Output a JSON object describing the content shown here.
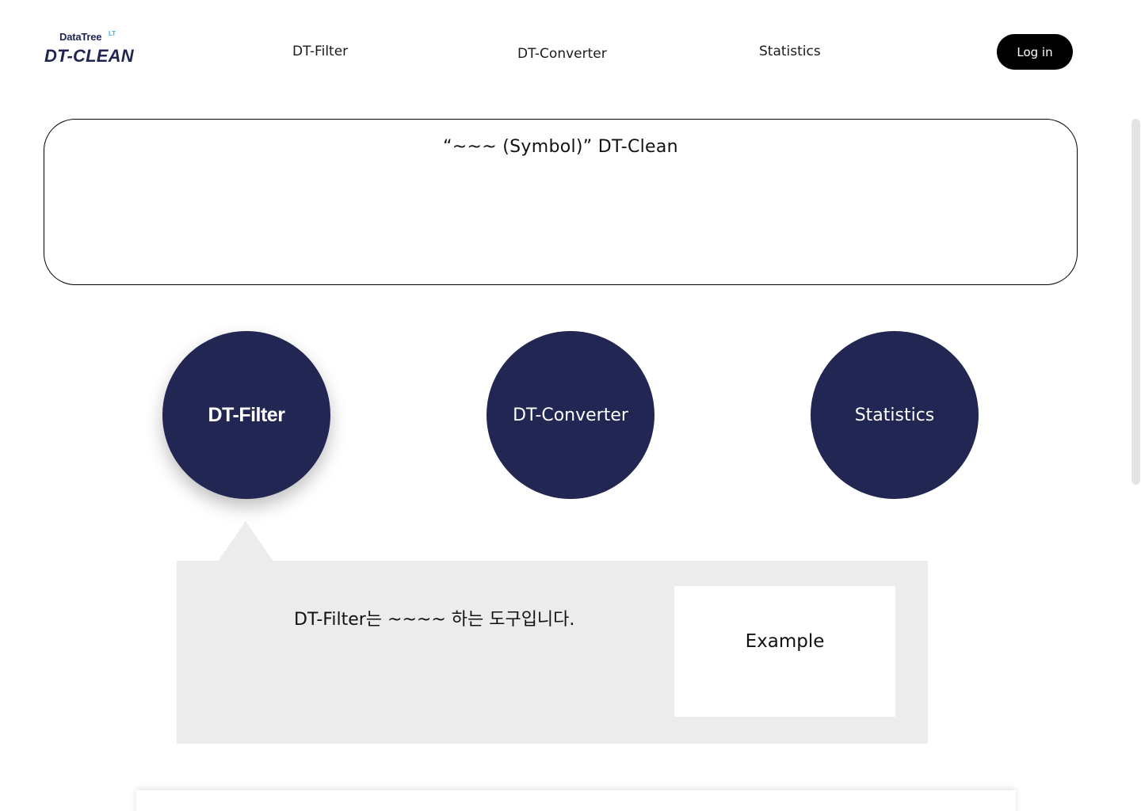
{
  "header": {
    "logo": {
      "top_text": "DataTree",
      "badge_text": "LT",
      "main_text": "DT-CLEAN"
    },
    "nav": [
      {
        "label": "DT-Filter"
      },
      {
        "label": "DT-Converter"
      },
      {
        "label": "Statistics"
      }
    ],
    "login_label": "Log in"
  },
  "hero": {
    "title": "“~~~ (Symbol)” DT-Clean"
  },
  "features": [
    {
      "label": "DT-Filter",
      "selected": true
    },
    {
      "label": "DT-Converter",
      "selected": false
    },
    {
      "label": "Statistics",
      "selected": false
    }
  ],
  "description": {
    "text": "DT-Filter는 ~~~~ 하는 도구입니다.",
    "example_label": "Example"
  },
  "colors": {
    "primary_navy": "#222652",
    "panel_gray": "#ececec",
    "logo_accent": "#3fb4e6",
    "button_black": "#000000"
  }
}
